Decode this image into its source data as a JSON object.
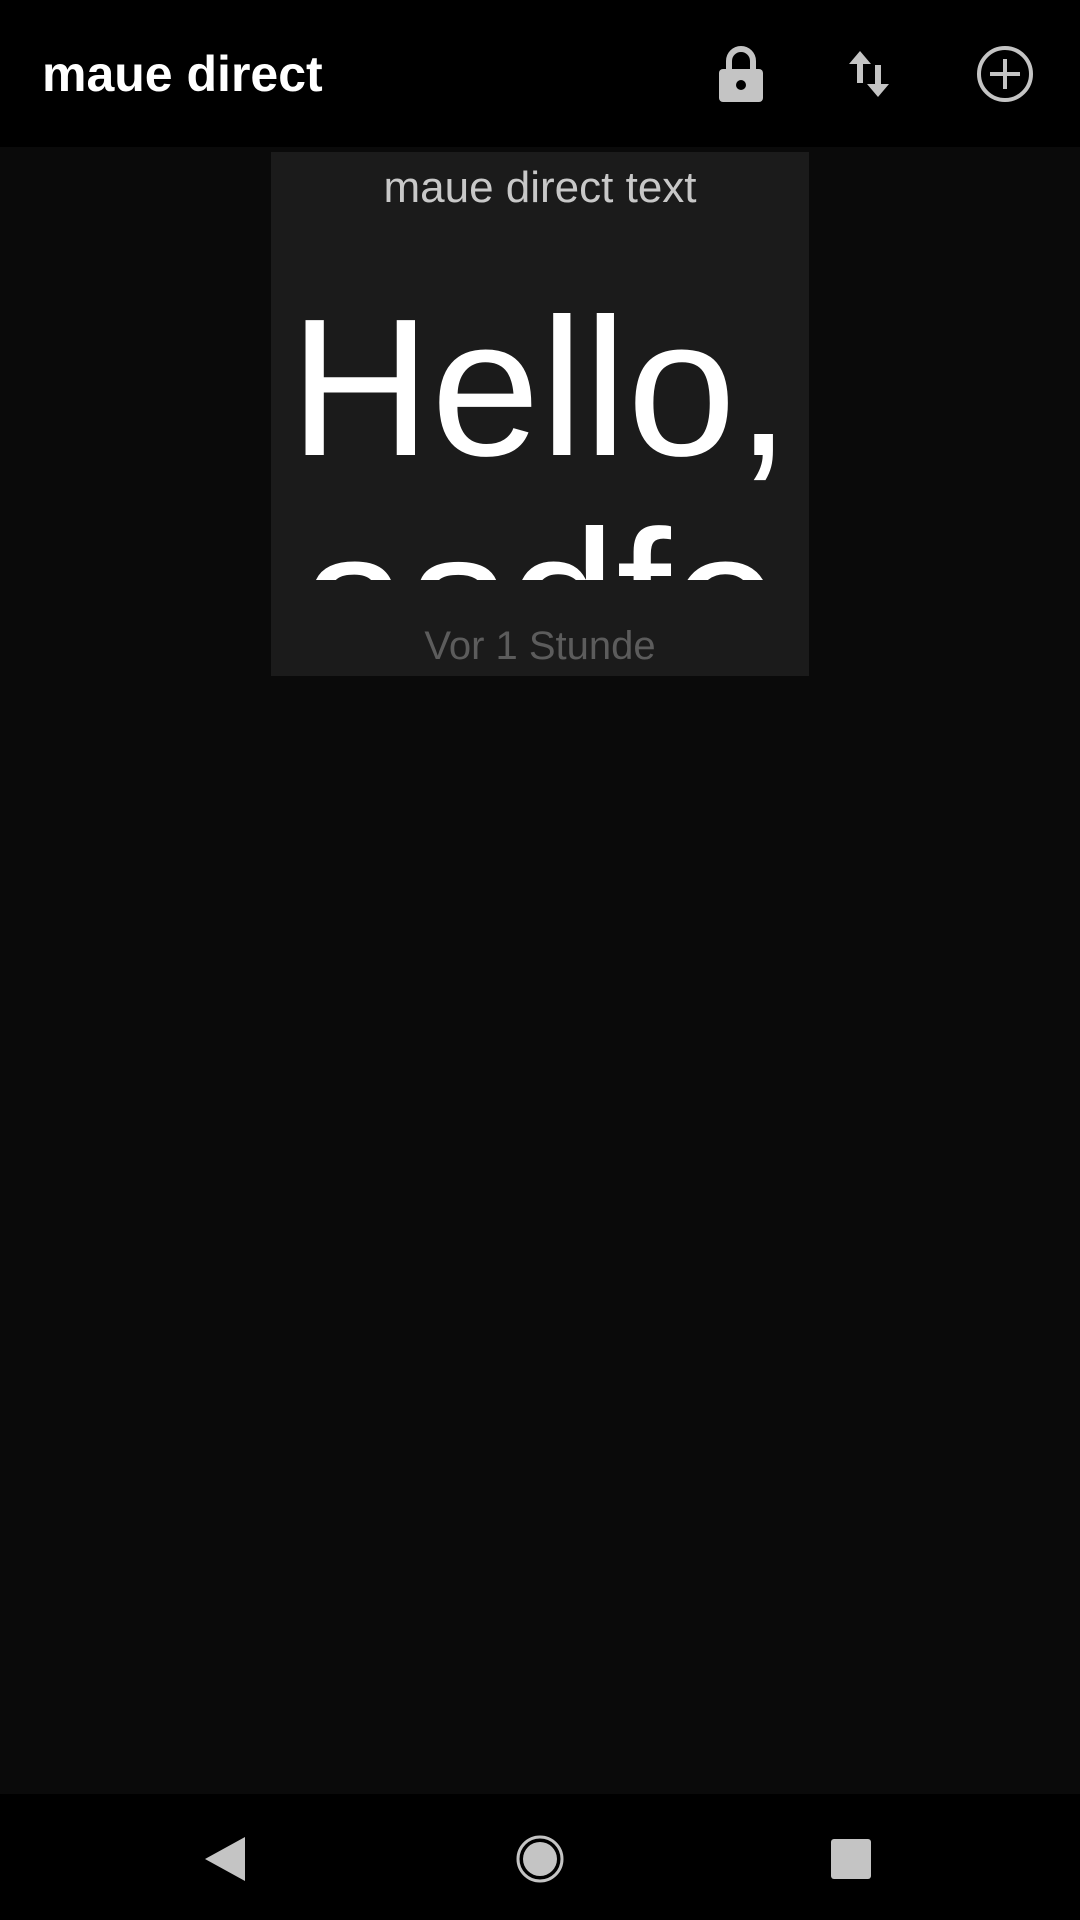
{
  "appbar": {
    "title": "maue direct",
    "actions": [
      {
        "icon": "lock-icon"
      },
      {
        "icon": "sort-icon"
      },
      {
        "icon": "add-circle-icon"
      }
    ]
  },
  "note_card": {
    "title": "maue direct text",
    "body": "Hello,\nasdfe",
    "timestamp": "Vor 1 Stunde"
  },
  "navbar": {
    "buttons": [
      {
        "icon": "back-icon"
      },
      {
        "icon": "home-icon"
      },
      {
        "icon": "recents-icon"
      }
    ]
  },
  "colors": {
    "appbar_bg": "#000000",
    "page_bg": "#0a0a0a",
    "card_bg": "#1b1b1b",
    "title_text": "#ffffff",
    "card_title_text": "#c8c8c8",
    "timestamp_text": "#5c5c5c",
    "icon": "#c4c4c4"
  }
}
